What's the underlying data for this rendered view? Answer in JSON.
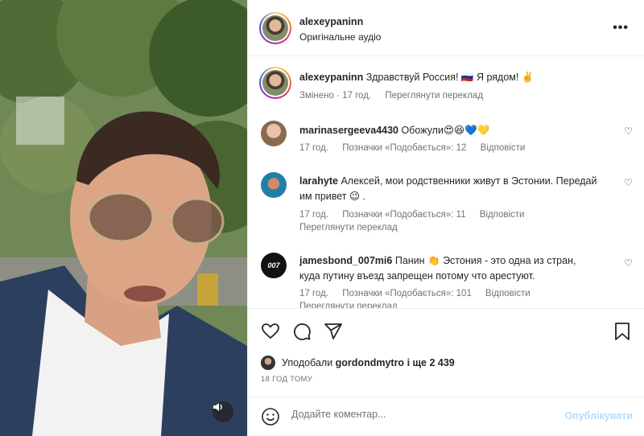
{
  "post": {
    "author": "alexeypaninn",
    "audio": "Оригінальне аудіо",
    "more_icon": "more-horizontal-icon",
    "caption_user": "alexeypaninn",
    "caption_text": "Здравствуй Россия! 🇷🇺 Я рядом! ✌️",
    "caption_meta_edited": "Змінено · 17 год.",
    "caption_translate": "Переглянути переклад"
  },
  "comments": [
    {
      "user": "marinasergeeva4430",
      "text": "Обожули😍😆💙💛",
      "time": "17 год.",
      "likes": "Позначки «Подобається»: 12",
      "reply": "Відповісти"
    },
    {
      "user": "larahyte",
      "text": "Алексей, мои родственники живут в Эстонии. Передай им привет 😉 .",
      "time": "17 год.",
      "likes": "Позначки «Подобається»: 11",
      "reply": "Відповісти",
      "translate": "Переглянути переклад"
    },
    {
      "user": "jamesbond_007mi6",
      "avatar_text": "007",
      "text": "Панин 👏 Эстония - это одна из стран, куда путину въезд запрещен потому что арестуют.",
      "time": "17 год.",
      "likes": "Позначки «Подобається»: 101",
      "reply": "Відповісти",
      "translate": "Переглянути переклад"
    }
  ],
  "actions": {
    "like_icon": "heart-icon",
    "comment_icon": "comment-icon",
    "share_icon": "share-icon",
    "save_icon": "bookmark-icon"
  },
  "likes": {
    "prefix": "Уподобали",
    "user": "gordondmytro",
    "suffix": "і ще 2 439"
  },
  "time_ago": "18 ГОД ТОМУ",
  "composer": {
    "placeholder": "Додайте коментар...",
    "publish": "Опублікувати",
    "emoji_icon": "emoji-icon"
  },
  "media": {
    "sound_icon": "speaker-icon"
  },
  "colors": {
    "link_disabled": "#b3dbff",
    "meta_text": "#737373",
    "border": "#efefef"
  }
}
